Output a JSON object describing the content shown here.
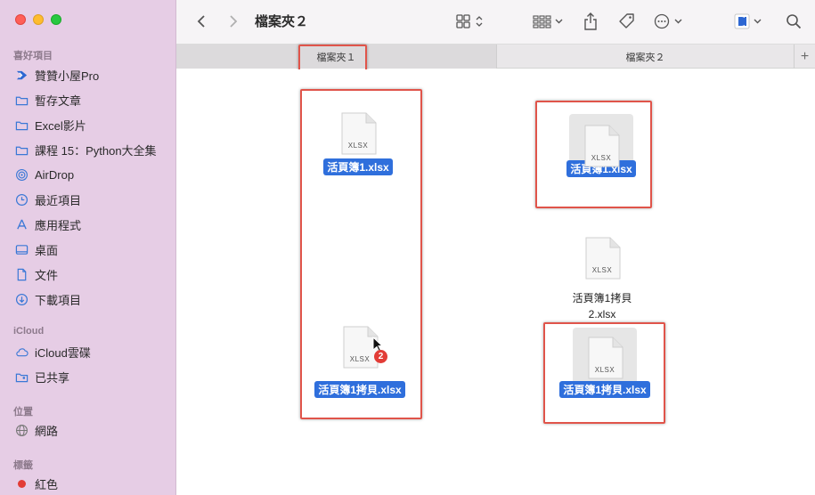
{
  "window": {
    "title": "檔案夾２"
  },
  "sidebar": {
    "favorites_title": "喜好項目",
    "favorites": [
      {
        "label": "贊贊小屋Pro",
        "icon": "app-icon"
      },
      {
        "label": "暫存文章",
        "icon": "folder-icon"
      },
      {
        "label": "Excel影片",
        "icon": "folder-icon"
      },
      {
        "label": "課程 15：Python大全集",
        "icon": "folder-icon"
      },
      {
        "label": "AirDrop",
        "icon": "airdrop-icon"
      },
      {
        "label": "最近項目",
        "icon": "clock-icon"
      },
      {
        "label": "應用程式",
        "icon": "applications-icon"
      },
      {
        "label": "桌面",
        "icon": "desktop-icon"
      },
      {
        "label": "文件",
        "icon": "document-icon"
      },
      {
        "label": "下載項目",
        "icon": "download-icon"
      }
    ],
    "icloud_title": "iCloud",
    "icloud": [
      {
        "label": "iCloud雲碟",
        "icon": "cloud-icon"
      },
      {
        "label": "已共享",
        "icon": "shared-folder-icon"
      }
    ],
    "locations_title": "位置",
    "locations": [
      {
        "label": "網路",
        "icon": "network-icon"
      }
    ],
    "tags_title": "標籤",
    "tags": [
      {
        "label": "紅色",
        "color": "#e23c36"
      }
    ]
  },
  "tabs": [
    {
      "label": "檔案夾１",
      "active": true
    },
    {
      "label": "檔案夾２",
      "active": false
    }
  ],
  "tab_add": "+",
  "files": {
    "left_top": {
      "ext": "XLSX",
      "name": "活頁簿1.xlsx"
    },
    "left_bottom": {
      "ext": "XLSX",
      "name": "活頁簿1拷貝.xlsx",
      "badge": "2"
    },
    "right_top": {
      "ext": "XLSX",
      "name": "活頁簿1.xlsx"
    },
    "right_mid": {
      "ext": "XLSX",
      "name_line1": "活頁簿1拷貝",
      "name_line2": "2.xlsx"
    },
    "right_bottom": {
      "ext": "XLSX",
      "name": "活頁簿1拷貝.xlsx"
    }
  },
  "colors": {
    "sidebar": "#e6cde5",
    "selection": "#2f6fdc",
    "highlight": "#e0544a"
  }
}
